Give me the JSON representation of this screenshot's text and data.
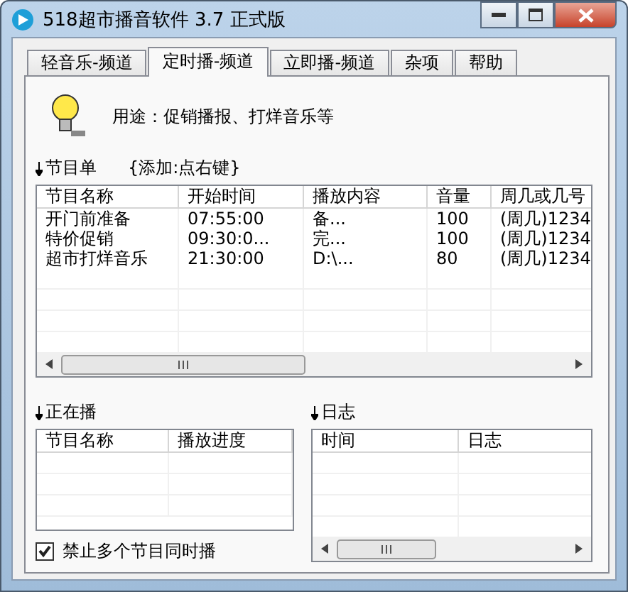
{
  "window": {
    "title": "518超市播音软件 3.7 正式版"
  },
  "tabs": [
    {
      "label": "轻音乐-频道",
      "selected": false
    },
    {
      "label": "定时播-频道",
      "selected": true
    },
    {
      "label": "立即播-频道",
      "selected": false
    },
    {
      "label": "杂项",
      "selected": false
    },
    {
      "label": "帮助",
      "selected": false
    }
  ],
  "purpose": "用途：促销播报、打烊音乐等",
  "program_list": {
    "label": "节目单",
    "hint": "{添加:点右键}",
    "columns": [
      "节目名称",
      "开始时间",
      "播放内容",
      "音量",
      "周几或几号"
    ],
    "rows": [
      [
        "开门前准备",
        "07:55:00",
        "备...",
        "100",
        "(周几)1234"
      ],
      [
        "特价促销",
        "09:30:0...",
        "完...",
        "100",
        "(周几)1234"
      ],
      [
        "超市打烊音乐",
        "21:30:00",
        "D:\\...",
        "80",
        "(周几)1234"
      ]
    ]
  },
  "now_playing": {
    "label": "正在播",
    "columns": [
      "节目名称",
      "播放进度"
    ]
  },
  "log": {
    "label": "日志",
    "columns": [
      "时间",
      "日志"
    ]
  },
  "no_simultaneous": {
    "label": "禁止多个节目同时播",
    "checked": true
  }
}
